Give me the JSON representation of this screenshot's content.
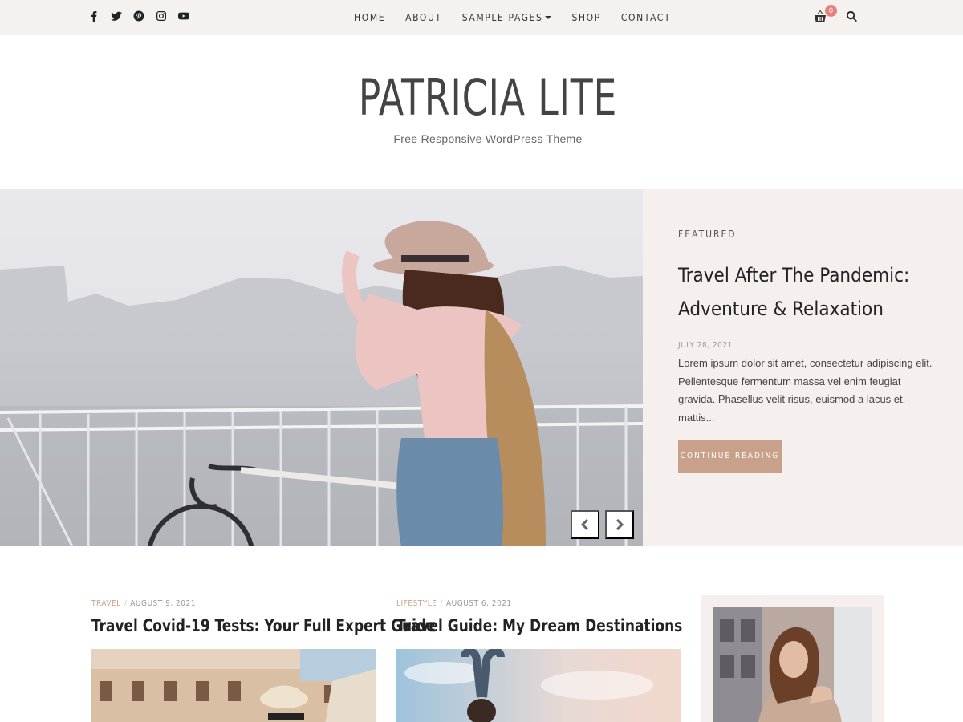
{
  "topbar": {
    "social_icons": [
      "facebook-icon",
      "twitter-icon",
      "pinterest-icon",
      "instagram-icon",
      "youtube-icon"
    ],
    "nav": [
      {
        "label": "HOME"
      },
      {
        "label": "ABOUT"
      },
      {
        "label": "SAMPLE PAGES",
        "has_dropdown": true
      },
      {
        "label": "SHOP"
      },
      {
        "label": "CONTACT"
      }
    ],
    "cart_count": "0"
  },
  "header": {
    "title": "PATRICIA LITE",
    "tagline": "Free Responsive WordPress Theme"
  },
  "featured": {
    "label": "FEATURED",
    "title": "Travel After The Pandemic: Adventure & Relaxation",
    "date": "JULY 28, 2021",
    "excerpt": "Lorem ipsum dolor sit amet, consectetur adipiscing elit. Pellentesque fermentum massa vel enim feugiat gravida. Phasellus velit risus, euismod a lacus et, mattis...",
    "button": "CONTINUE READING"
  },
  "posts": [
    {
      "category": "TRAVEL",
      "date": "AUGUST 9, 2021",
      "title": "Travel Covid-19 Tests: Your Full Expert Guide"
    },
    {
      "category": "LIFESTYLE",
      "date": "AUGUST 6, 2021",
      "title": "Travel Guide: My Dream Destinations"
    }
  ],
  "colors": {
    "topbar_bg": "#f5f1ee",
    "accent": "#c9a18a",
    "badge": "#e6807b",
    "panel_bg": "#f5f0ed"
  }
}
